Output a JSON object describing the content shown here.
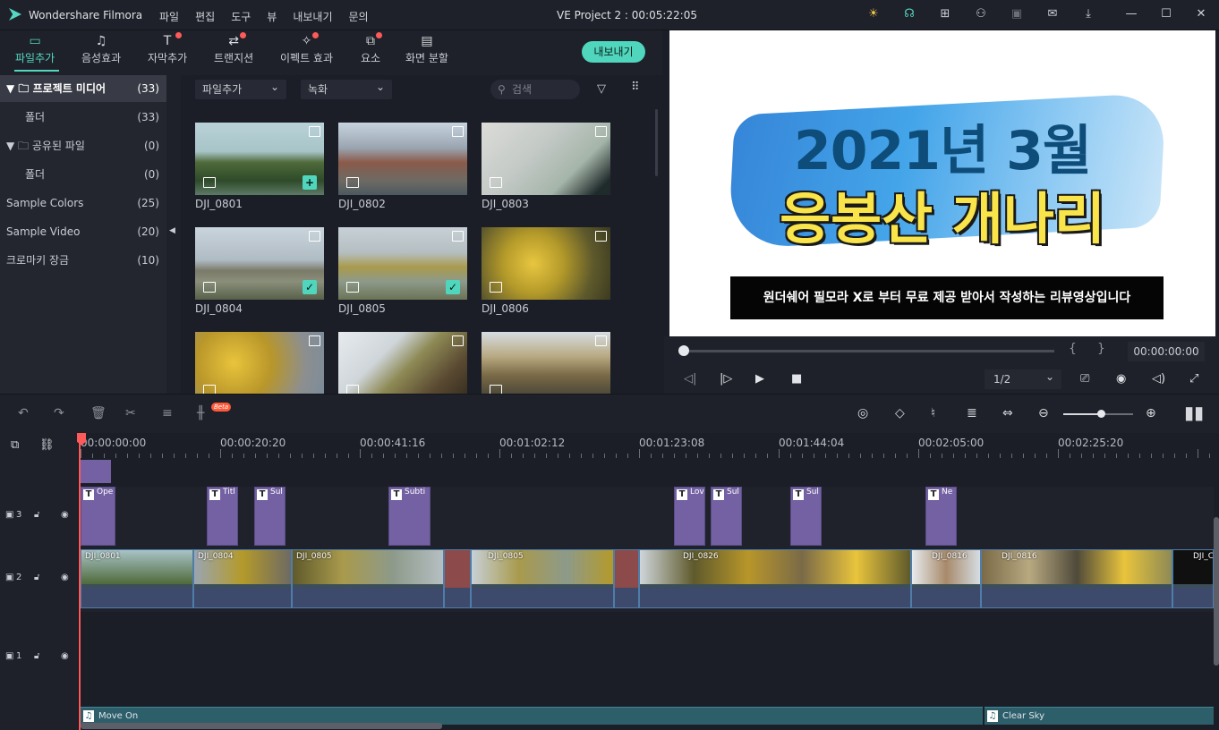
{
  "app": {
    "name": "Wondershare Filmora",
    "project_title": "VE Project 2 : 00:05:22:05"
  },
  "menu": [
    "파일",
    "편집",
    "도구",
    "뷰",
    "내보내기",
    "문의"
  ],
  "window_icons": [
    "bulb-icon",
    "headset-icon",
    "gift-icon",
    "account-icon",
    "save-icon",
    "mail-icon",
    "download-icon",
    "minimize-icon",
    "maximize-icon",
    "close-icon"
  ],
  "tabs": [
    {
      "label": "파일추가",
      "icon": "folder-icon",
      "active": true,
      "dot": false
    },
    {
      "label": "음성효과",
      "icon": "music-icon",
      "active": false,
      "dot": false
    },
    {
      "label": "자막추가",
      "icon": "text-icon",
      "active": false,
      "dot": true
    },
    {
      "label": "트랜지션",
      "icon": "transition-icon",
      "active": false,
      "dot": true
    },
    {
      "label": "이펙트 효과",
      "icon": "effects-icon",
      "active": false,
      "dot": true
    },
    {
      "label": "요소",
      "icon": "elements-icon",
      "active": false,
      "dot": true
    },
    {
      "label": "화면 분할",
      "icon": "splitscreen-icon",
      "active": false,
      "dot": false
    }
  ],
  "export_label": "내보내기",
  "sidebar": [
    {
      "label": "▼ 🗀 프로젝트 미디어",
      "count": "(33)",
      "selected": true
    },
    {
      "label": "폴더",
      "count": "(33)",
      "selected": false,
      "indent": true
    },
    {
      "label": "▼ 🗀 공유된 파일",
      "count": "(0)",
      "selected": false
    },
    {
      "label": "폴더",
      "count": "(0)",
      "selected": false,
      "indent": true
    },
    {
      "label": "Sample Colors",
      "count": "(25)",
      "selected": false
    },
    {
      "label": "Sample Video",
      "count": "(20)",
      "selected": false
    },
    {
      "label": "크로마키 장금",
      "count": "(10)",
      "selected": false
    }
  ],
  "filters": {
    "import": "파일추가",
    "record": "녹화",
    "search_placeholder": "검색"
  },
  "media": [
    {
      "name": "DJI_0801",
      "status": "add"
    },
    {
      "name": "DJI_0802",
      "status": "none"
    },
    {
      "name": "DJI_0803",
      "status": "none"
    },
    {
      "name": "DJI_0804",
      "status": "check"
    },
    {
      "name": "DJI_0805",
      "status": "check"
    },
    {
      "name": "DJI_0806",
      "status": "none"
    },
    {
      "name": "",
      "status": "none"
    },
    {
      "name": "",
      "status": "none"
    },
    {
      "name": "",
      "status": "none"
    }
  ],
  "preview": {
    "line1": "2021년 3월",
    "line2": "응봉산 개나리",
    "subtitle": "원더쉐어 필모라 X로 부터 무료 제공 받아서 작성하는 리뷰영상입니다",
    "timecode": "00:00:00:00",
    "bracket_in": "{",
    "bracket_out": "}",
    "ratio": "1/2"
  },
  "ruler_labels": [
    "00:00:00:00",
    "00:00:20:20",
    "00:00:41:16",
    "00:01:02:12",
    "00:01:23:08",
    "00:01:44:04",
    "00:02:05:00",
    "00:02:25:20"
  ],
  "tracks": {
    "t3": "3",
    "t2": "2",
    "t1": "1"
  },
  "title_clips": [
    "Ope",
    "Titl",
    "Sul",
    "Subti",
    "Lov",
    "Sul",
    "Sul",
    "Ne"
  ],
  "video_clips": [
    "DJI_0801",
    "DJI_0804",
    "DJI_0805",
    "DJI_0805",
    "DJI_0826",
    "DJI_0816",
    "DJI_0816",
    "DJI_C"
  ],
  "audio_clips": [
    "Move On",
    "Clear Sky"
  ],
  "beta_label": "Beta",
  "colors": {
    "accent": "#55d6c0",
    "title_clip": "#7461a3",
    "playhead": "#ff5a5a"
  }
}
